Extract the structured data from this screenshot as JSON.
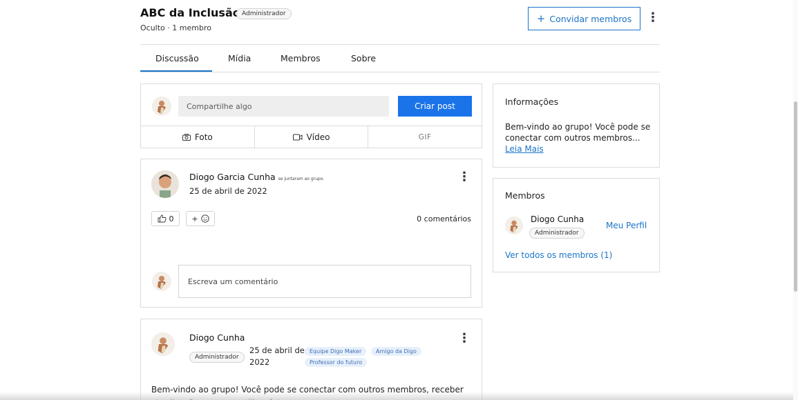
{
  "group": {
    "name": "ABC da Inclusão",
    "role": "Administrador",
    "subtitle": "Oculto · 1 membro",
    "invite_label": "Convidar membros",
    "invite_icon": "plus-icon"
  },
  "tabs": [
    {
      "label": "Discussão",
      "active": true
    },
    {
      "label": "Mídia",
      "active": false
    },
    {
      "label": "Membros",
      "active": false
    },
    {
      "label": "Sobre",
      "active": false
    }
  ],
  "composer": {
    "placeholder": "Compartilhe algo",
    "create_label": "Criar post",
    "media": [
      {
        "label": "Foto",
        "icon": "camera-icon"
      },
      {
        "label": "Vídeo",
        "icon": "video-icon"
      },
      {
        "label": "GIF",
        "icon": ""
      }
    ]
  },
  "post1": {
    "author": "Diogo Garcia Cunha",
    "action": "se juntaram ao grupo.",
    "date": "25 de abril de 2022",
    "likes": "0",
    "react_label": "+",
    "comments": "0 comentários",
    "comment_placeholder": "Escreva um comentário"
  },
  "post2": {
    "author": "Diogo Cunha",
    "role": "Administrador",
    "date_line1": "25 de abril de",
    "date_line2": "2022",
    "tags": [
      "Equipe Digo Maker",
      "Amigo da Digo",
      "Professor do futuro"
    ],
    "body": "Bem-vindo ao grupo! Você pode se conectar com outros membros, receber atualizações e compartilhar fotos."
  },
  "info": {
    "title": "Informações",
    "text": "Bem-vindo ao grupo! Você pode se conectar com outros membros...",
    "more": "Leia Mais"
  },
  "members": {
    "title": "Membros",
    "name": "Diogo Cunha",
    "role": "Administrador",
    "profile_link": "Meu Perfil",
    "all_link": "Ver todos os membros (1)"
  },
  "colors": {
    "accent": "#1a73e8",
    "link": "#1a73c8",
    "chip_bg": "#e7f0fb",
    "chip_text": "#3f6fb5"
  }
}
